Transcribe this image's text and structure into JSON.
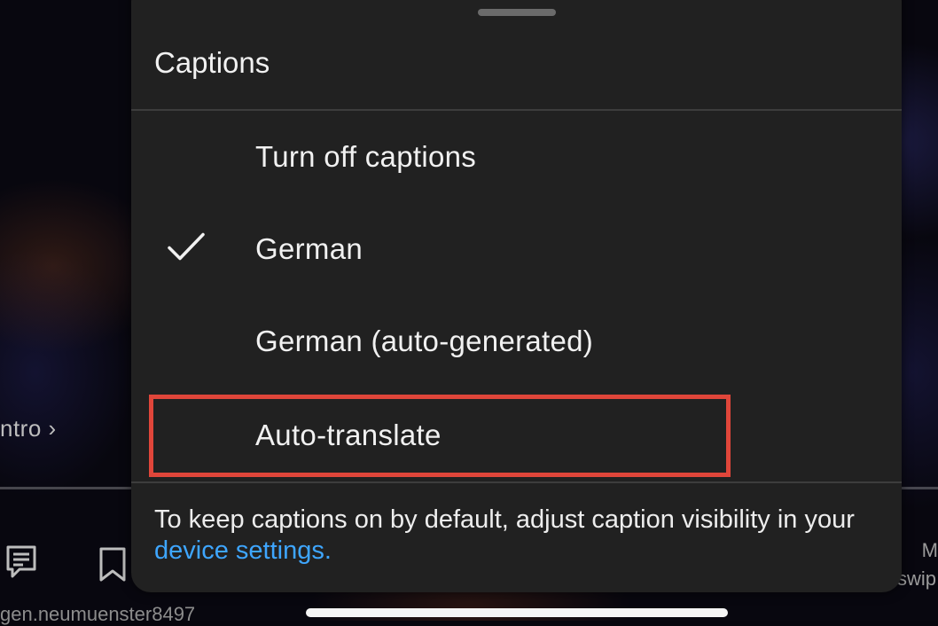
{
  "background": {
    "chapter_label": "ntro ›",
    "username": "gen.neumuenster8497",
    "side_text": "swip",
    "side_letter": "M",
    "icons": [
      "comment-icon",
      "bookmark-icon"
    ]
  },
  "sheet": {
    "title": "Captions",
    "options": [
      {
        "label": "Turn off captions",
        "selected": false
      },
      {
        "label": "German",
        "selected": true
      },
      {
        "label": "German (auto-generated)",
        "selected": false
      },
      {
        "label": "Auto-translate",
        "selected": false
      }
    ],
    "footer_text": "To keep captions on by default, adjust caption visibility in your ",
    "footer_link": "device settings."
  },
  "colors": {
    "sheet_bg": "#212121",
    "link": "#3ea6ff",
    "highlight": "#e0463a",
    "text": "#f1f1f1"
  }
}
